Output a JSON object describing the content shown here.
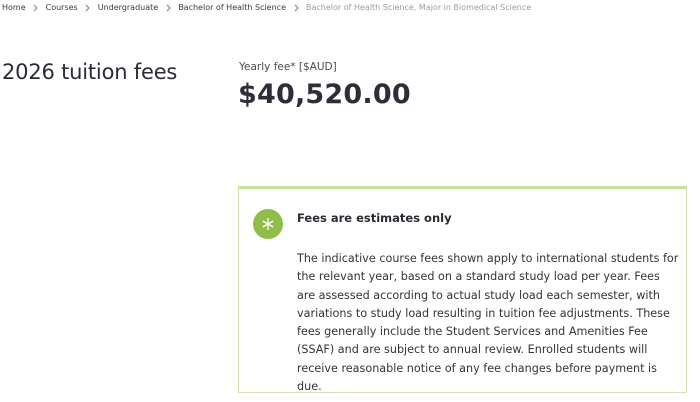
{
  "breadcrumb": {
    "items": [
      {
        "label": "Home"
      },
      {
        "label": "Courses"
      },
      {
        "label": "Undergraduate"
      },
      {
        "label": "Bachelor of Health Science"
      },
      {
        "label": "Bachelor of Health Science, Major in Biomedical Science"
      }
    ],
    "separator_icon": "chevron-right-icon"
  },
  "fees": {
    "heading": "2026 tuition fees",
    "yearly_fee_label": "Yearly fee* [$AUD]",
    "yearly_fee_amount": "$40,520.00"
  },
  "notice": {
    "icon": "asterisk-icon",
    "icon_color": "#8fbd4a",
    "border_color": "#c9dfa0",
    "title": "Fees are estimates only",
    "body": "The indicative course fees shown apply to international students for the relevant year, based on a standard study load per year. Fees are assessed according to actual study load each semester, with variations to study load resulting in tuition fee adjustments. These fees generally include the Student Services and Amenities Fee (SSAF) and are subject to annual review. Enrolled students will receive reasonable notice of any fee changes before payment is due."
  }
}
